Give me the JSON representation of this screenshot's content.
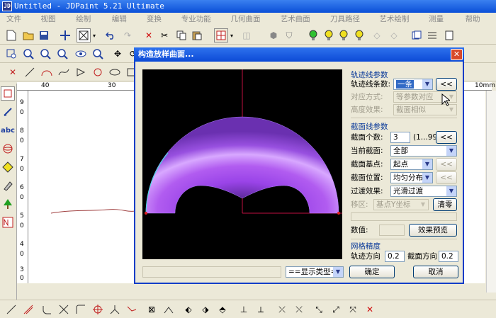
{
  "app": {
    "title": "Untitled - JDPaint 5.21 Ultimate",
    "icon_label": "JD"
  },
  "menu": [
    "文件(F)",
    "视图(V)",
    "绘制(D)",
    "编辑(E)",
    "变换(T)",
    "专业功能(E)",
    "几何曲面(B)",
    "艺术曲面(A)",
    "刀具路径(P)",
    "艺术绘制(S)",
    "测量(M)",
    "帮助(H)"
  ],
  "ruler": {
    "h_labels": [
      "40",
      "30",
      "10mm"
    ],
    "v_labels": [
      "9",
      "0",
      "8",
      "0",
      "7",
      "0",
      "6",
      "0",
      "5",
      "0",
      "4",
      "0",
      "3",
      "0"
    ]
  },
  "left_toolbar": {
    "abc_label": "abc"
  },
  "dialog": {
    "title": "构造放样曲面...",
    "close_label": "✕",
    "display_type": "==显示类型==",
    "status_value": "",
    "track_section": {
      "heading": "轨迹线参数",
      "track_count_label": "轨迹线条数:",
      "track_count_value": "一条",
      "corr_mode_label": "对应方式:",
      "corr_mode_value": "等参数对应",
      "height_effect_label": "高度效果:",
      "height_effect_value": "截面相似",
      "collapse_label": "<<"
    },
    "profile_section": {
      "heading": "截面线参数",
      "profile_count_label": "截面个数:",
      "profile_count_value": "3",
      "profile_range": "(1...99)",
      "current_profile_label": "当前截面:",
      "current_profile_value": "全部",
      "base_point_label": "截面基点:",
      "base_point_value": "起点",
      "position_label": "截面位置:",
      "position_value": "均匀分布",
      "transition_label": "过渡效果:",
      "transition_value": "光滑过渡",
      "shift_label": "移区:",
      "shift_value": "基点Y坐标",
      "clear_label": "清零",
      "x_value_label": "数值:",
      "x_value": "",
      "preview_effect_label": "效果预览"
    },
    "mesh_section": {
      "heading": "网格精度",
      "track_dir_label": "轨迹方向",
      "track_dir_value": "0.2",
      "profile_dir_label": "截面方向",
      "profile_dir_value": "0.2"
    },
    "ok_label": "确定",
    "cancel_label": "取消"
  }
}
